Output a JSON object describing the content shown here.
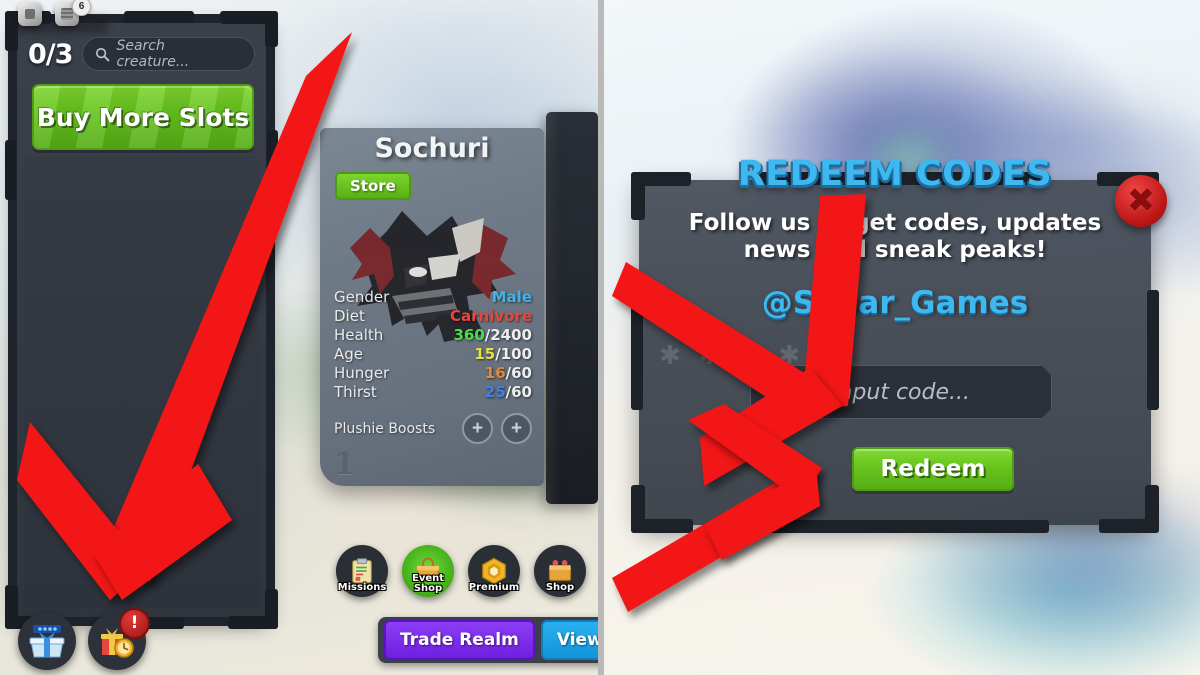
{
  "roblox_overlay": {
    "icons": [
      {
        "name": "roblox-menu-icon",
        "badge": ""
      },
      {
        "name": "roblox-chat-icon",
        "badge": "6"
      }
    ]
  },
  "left_panel": {
    "inventory": {
      "slot_count": "0/3",
      "search_placeholder": "Search creature...",
      "buy_more_slots_label": "Buy More Slots"
    },
    "creature_card": {
      "name": "Sochuri",
      "store_tag": "Store",
      "stats": [
        {
          "label": "Gender",
          "value": "Male",
          "max": "",
          "color": "#3fb4e8"
        },
        {
          "label": "Diet",
          "value": "Carnivore",
          "max": "",
          "color": "#e8473f"
        },
        {
          "label": "Health",
          "value": "360",
          "max": "/2400",
          "color": "#4ddc4d"
        },
        {
          "label": "Age",
          "value": "15",
          "max": "/100",
          "color": "#e8e23f"
        },
        {
          "label": "Hunger",
          "value": "16",
          "max": "/60",
          "color": "#e08a3c"
        },
        {
          "label": "Thirst",
          "value": "25",
          "max": "/60",
          "color": "#3f7fe8"
        }
      ],
      "plushie_boosts_label": "Plushie Boosts",
      "plus_button_label": "+",
      "card_number": "1"
    },
    "bottom_nav": [
      {
        "label": "Missions",
        "icon": "clipboard-icon",
        "highlight": false
      },
      {
        "label": "Event\nShop",
        "icon": "shop-basket-icon",
        "highlight": true
      },
      {
        "label": "Premium",
        "icon": "gem-badge-icon",
        "highlight": false
      },
      {
        "label": "Shop",
        "icon": "shop-cart-icon",
        "highlight": false
      }
    ],
    "trade_bar": {
      "trade_realm_label": "Trade Realm",
      "view_creatures_label": "View Cre"
    },
    "gift_icons": [
      {
        "name": "daily-rewards-gift-icon",
        "badge": ""
      },
      {
        "name": "timed-gift-icon",
        "badge": "!"
      }
    ]
  },
  "right_panel": {
    "redeem_dialog": {
      "title": "REDEEM CODES",
      "subtitle": "Follow us to get codes, updates news and sneak peaks!",
      "handle": "@Sonar_Games",
      "input_placeholder": "Input code...",
      "redeem_button_label": "Redeem",
      "close_label": "✖"
    }
  },
  "colors": {
    "accent_blue": "#3fb8ef",
    "accent_green": "#68c41d",
    "arrow_red": "#f21515",
    "panel_dark": "#1d2128"
  }
}
